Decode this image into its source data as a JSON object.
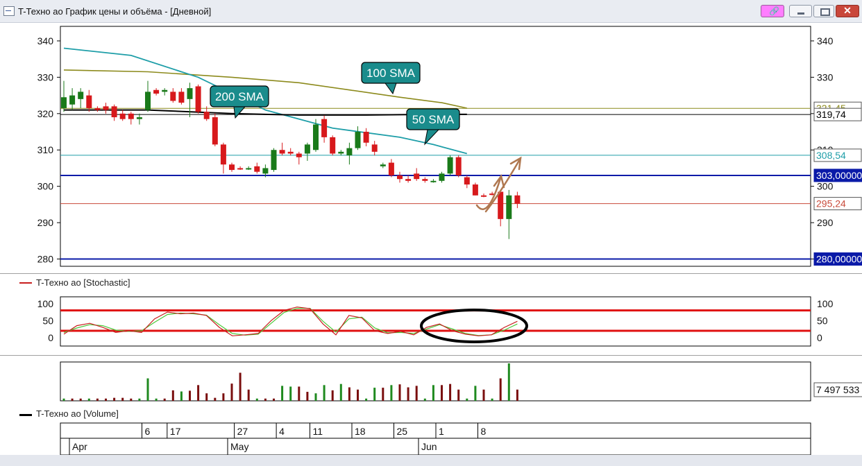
{
  "window": {
    "title": "T-Техно ао График цены и объёма - [Дневной]"
  },
  "legends": {
    "stochastic": "T-Техно ао [Stochastic]",
    "volume": "T-Техно ао [Volume]"
  },
  "colors": {
    "up": "#1a7a1a",
    "down": "#d7191c",
    "vol_up": "#1f8a1f",
    "vol_down": "#7a0e0e",
    "sma50": "#1e9ea8",
    "sma100": "#8c8a1c",
    "sma200": "#000000",
    "level_blue": "#0a1aa8",
    "level_red": "#c84a3a",
    "stoch_band": "#e01010",
    "stoch_k": "#c81e1e",
    "stoch_d": "#4cc83a",
    "callout": "#1a8c8c",
    "arrow": "#b07850"
  },
  "chart_data": [
    {
      "type": "candlestick",
      "title": "T-Техно ао",
      "y_ticks": [
        280,
        290,
        300,
        310,
        320,
        330,
        340
      ],
      "ylim": [
        278,
        344
      ],
      "x_ticks": [
        {
          "label": "6",
          "idx": 5
        },
        {
          "label": "17",
          "idx": 8
        },
        {
          "label": "27",
          "idx": 16
        },
        {
          "label": "4",
          "idx": 21
        },
        {
          "label": "11",
          "idx": 25
        },
        {
          "label": "18",
          "idx": 30
        },
        {
          "label": "25",
          "idx": 35
        },
        {
          "label": "1",
          "idx": 40
        },
        {
          "label": "8",
          "idx": 45
        }
      ],
      "months": [
        {
          "label": "Apr",
          "idx": 1
        },
        {
          "label": "May",
          "idx": 19
        },
        {
          "label": "Jun",
          "idx": 40
        }
      ],
      "candles": [
        {
          "o": 321.5,
          "h": 329,
          "l": 320.5,
          "c": 324.5
        },
        {
          "o": 322.5,
          "h": 327,
          "l": 321,
          "c": 325
        },
        {
          "o": 324,
          "h": 327,
          "l": 321.5,
          "c": 326
        },
        {
          "o": 325,
          "h": 326.5,
          "l": 320.5,
          "c": 321.5
        },
        {
          "o": 321.5,
          "h": 322,
          "l": 320.5,
          "c": 321
        },
        {
          "o": 322,
          "h": 323,
          "l": 320,
          "c": 321
        },
        {
          "o": 322,
          "h": 322.5,
          "l": 318,
          "c": 319
        },
        {
          "o": 320,
          "h": 321,
          "l": 318,
          "c": 318.5
        },
        {
          "o": 320,
          "h": 320.5,
          "l": 317,
          "c": 318.5
        },
        {
          "o": 318.5,
          "h": 320,
          "l": 317,
          "c": 319
        },
        {
          "o": 321,
          "h": 329,
          "l": 320.5,
          "c": 326
        },
        {
          "o": 326.5,
          "h": 327,
          "l": 325,
          "c": 325.5
        },
        {
          "o": 326,
          "h": 327,
          "l": 325,
          "c": 326.5
        },
        {
          "o": 326,
          "h": 327,
          "l": 323,
          "c": 323.5
        },
        {
          "o": 326,
          "h": 327,
          "l": 322.5,
          "c": 323
        },
        {
          "o": 324,
          "h": 328.5,
          "l": 319,
          "c": 327
        },
        {
          "o": 327.5,
          "h": 328,
          "l": 320,
          "c": 320.5
        },
        {
          "o": 320.5,
          "h": 322,
          "l": 318,
          "c": 318.5
        },
        {
          "o": 319,
          "h": 320,
          "l": 311,
          "c": 311.5
        },
        {
          "o": 311.5,
          "h": 312,
          "l": 303.5,
          "c": 306
        },
        {
          "o": 306,
          "h": 306.5,
          "l": 304,
          "c": 304.5
        },
        {
          "o": 305,
          "h": 305.5,
          "l": 304.5,
          "c": 304.8
        },
        {
          "o": 305,
          "h": 305.5,
          "l": 304.5,
          "c": 305
        },
        {
          "o": 305.5,
          "h": 306.5,
          "l": 303.5,
          "c": 304
        },
        {
          "o": 303.5,
          "h": 306,
          "l": 302.5,
          "c": 305
        },
        {
          "o": 304.5,
          "h": 310.5,
          "l": 304,
          "c": 310
        },
        {
          "o": 310,
          "h": 312,
          "l": 308.5,
          "c": 309
        },
        {
          "o": 309.5,
          "h": 310.5,
          "l": 308.5,
          "c": 309
        },
        {
          "o": 309,
          "h": 309.5,
          "l": 306,
          "c": 308
        },
        {
          "o": 309,
          "h": 312,
          "l": 307,
          "c": 311.5
        },
        {
          "o": 310,
          "h": 318.5,
          "l": 309.5,
          "c": 317
        },
        {
          "o": 318.5,
          "h": 319.5,
          "l": 312,
          "c": 313.5
        },
        {
          "o": 313.5,
          "h": 314,
          "l": 308.5,
          "c": 309
        },
        {
          "o": 309,
          "h": 310,
          "l": 308.5,
          "c": 309.5
        },
        {
          "o": 308.5,
          "h": 312,
          "l": 306,
          "c": 310.5
        },
        {
          "o": 310.5,
          "h": 316.5,
          "l": 310,
          "c": 315
        },
        {
          "o": 315,
          "h": 316,
          "l": 311,
          "c": 312
        }
      ],
      "candles_tail": [
        {
          "o": 311.5,
          "h": 312.5,
          "l": 308.5,
          "c": 309.5
        },
        {
          "o": 305.5,
          "h": 306.5,
          "l": 305,
          "c": 306
        },
        {
          "o": 306.5,
          "h": 307.5,
          "l": 302.5,
          "c": 303
        },
        {
          "o": 303,
          "h": 304,
          "l": 301,
          "c": 302
        },
        {
          "o": 302,
          "h": 303,
          "l": 301,
          "c": 301.5
        },
        {
          "o": 303.5,
          "h": 305,
          "l": 301.5,
          "c": 302
        },
        {
          "o": 302,
          "h": 302.5,
          "l": 301,
          "c": 301.5
        },
        {
          "o": 301.5,
          "h": 302,
          "l": 301,
          "c": 301.5
        },
        {
          "o": 301.5,
          "h": 304,
          "l": 301,
          "c": 303.5
        },
        {
          "o": 303.5,
          "h": 308.5,
          "l": 303,
          "c": 308
        },
        {
          "o": 308,
          "h": 308.5,
          "l": 302.5,
          "c": 303
        },
        {
          "o": 302.5,
          "h": 303,
          "l": 299.5,
          "c": 300.5
        },
        {
          "o": 300.5,
          "h": 301,
          "l": 297.5,
          "c": 297.5
        },
        {
          "o": 297.5,
          "h": 298,
          "l": 297,
          "c": 297.3
        },
        {
          "o": 298,
          "h": 298.5,
          "l": 297.5,
          "c": 297.8
        },
        {
          "o": 298.5,
          "h": 299,
          "l": 289,
          "c": 291
        },
        {
          "o": 291,
          "h": 299,
          "l": 285.5,
          "c": 297.5
        },
        {
          "o": 297.5,
          "h": 298.5,
          "l": 294,
          "c": 295.2
        }
      ],
      "sma50": [
        [
          0,
          338
        ],
        [
          8,
          336
        ],
        [
          16,
          330
        ],
        [
          24,
          321
        ],
        [
          32,
          316
        ],
        [
          40,
          313.5
        ],
        [
          44,
          311.5
        ],
        [
          48,
          309
        ]
      ],
      "sma100": [
        [
          0,
          332
        ],
        [
          10,
          331.5
        ],
        [
          20,
          330
        ],
        [
          28,
          328.5
        ],
        [
          34,
          326.5
        ],
        [
          40,
          324.5
        ],
        [
          45,
          323
        ],
        [
          48,
          321.5
        ]
      ],
      "sma200": [
        [
          0,
          321
        ],
        [
          10,
          321
        ],
        [
          20,
          320
        ],
        [
          28,
          319.6
        ],
        [
          36,
          319.6
        ],
        [
          44,
          319.8
        ],
        [
          48,
          319.8
        ]
      ],
      "levels": [
        {
          "value": 321.45,
          "label": "321,45",
          "color": "#8c8a1c",
          "style": "thin"
        },
        {
          "value": 319.74,
          "label": "319,74",
          "color": "#000000",
          "style": "thin"
        },
        {
          "value": 308.54,
          "label": "308,54",
          "color": "#1e9ea8",
          "style": "thin"
        },
        {
          "value": 303.0,
          "label": "303,00000",
          "color": "#0a1aa8",
          "style": "thick"
        },
        {
          "value": 295.24,
          "label": "295,24",
          "color": "#c84a3a",
          "style": "thin"
        },
        {
          "value": 280.0,
          "label": "280,00000",
          "color": "#0a1aa8",
          "style": "thick"
        }
      ],
      "annotations": [
        {
          "text": "100 SMA"
        },
        {
          "text": "200 SMA"
        },
        {
          "text": "50 SMA"
        }
      ]
    },
    {
      "type": "line",
      "title": "T-Техно ао [Stochastic]",
      "y_ticks": [
        0,
        50,
        100
      ],
      "ylim": [
        -25,
        120
      ],
      "bands": [
        80,
        20
      ],
      "k": [
        10,
        35,
        42,
        30,
        15,
        20,
        15,
        55,
        75,
        70,
        72,
        65,
        30,
        5,
        8,
        12,
        50,
        80,
        90,
        85,
        40,
        8,
        65,
        58,
        20,
        12,
        18,
        8,
        30,
        40,
        20,
        10,
        5,
        8,
        30,
        48
      ],
      "d": [
        15,
        28,
        38,
        35,
        22,
        18,
        20,
        45,
        68,
        72,
        70,
        66,
        38,
        12,
        7,
        10,
        42,
        74,
        86,
        86,
        48,
        16,
        55,
        60,
        28,
        14,
        15,
        12,
        25,
        38,
        25,
        12,
        6,
        8,
        22,
        40
      ]
    },
    {
      "type": "bar",
      "title": "T-Техно ао [Volume]",
      "last_value_label": "7 497 533",
      "volumes": [
        {
          "v": 0.06,
          "up": true
        },
        {
          "v": 0.06,
          "up": false
        },
        {
          "v": 0.06,
          "up": false
        },
        {
          "v": 0.06,
          "up": true
        },
        {
          "v": 0.06,
          "up": false
        },
        {
          "v": 0.06,
          "up": false
        },
        {
          "v": 0.08,
          "up": false
        },
        {
          "v": 0.08,
          "up": false
        },
        {
          "v": 0.06,
          "up": false
        },
        {
          "v": 0.06,
          "up": true
        },
        {
          "v": 0.6,
          "up": true
        },
        {
          "v": 0.06,
          "up": true
        },
        {
          "v": 0.06,
          "up": false
        },
        {
          "v": 0.28,
          "up": false
        },
        {
          "v": 0.25,
          "up": true
        },
        {
          "v": 0.27,
          "up": false
        },
        {
          "v": 0.42,
          "up": false
        },
        {
          "v": 0.2,
          "up": false
        },
        {
          "v": 0.08,
          "up": false
        },
        {
          "v": 0.2,
          "up": false
        },
        {
          "v": 0.46,
          "up": false
        },
        {
          "v": 0.75,
          "up": false
        },
        {
          "v": 0.3,
          "up": false
        },
        {
          "v": 0.06,
          "up": true
        },
        {
          "v": 0.06,
          "up": false
        },
        {
          "v": 0.06,
          "up": false
        },
        {
          "v": 0.4,
          "up": true
        },
        {
          "v": 0.38,
          "up": true
        },
        {
          "v": 0.38,
          "up": false
        },
        {
          "v": 0.24,
          "up": false
        },
        {
          "v": 0.2,
          "up": true
        },
        {
          "v": 0.42,
          "up": true
        },
        {
          "v": 0.28,
          "up": false
        },
        {
          "v": 0.45,
          "up": true
        },
        {
          "v": 0.36,
          "up": false
        },
        {
          "v": 0.3,
          "up": false
        },
        {
          "v": 0.06,
          "up": true
        },
        {
          "v": 0.35,
          "up": true
        },
        {
          "v": 0.35,
          "up": false
        },
        {
          "v": 0.42,
          "up": true
        },
        {
          "v": 0.44,
          "up": false
        },
        {
          "v": 0.36,
          "up": false
        },
        {
          "v": 0.4,
          "up": false
        },
        {
          "v": 0.06,
          "up": true
        },
        {
          "v": 0.42,
          "up": true
        },
        {
          "v": 0.42,
          "up": false
        },
        {
          "v": 0.45,
          "up": false
        },
        {
          "v": 0.3,
          "up": false
        },
        {
          "v": 0.06,
          "up": true
        },
        {
          "v": 0.4,
          "up": true
        },
        {
          "v": 0.3,
          "up": false
        },
        {
          "v": 0.06,
          "up": true
        },
        {
          "v": 0.6,
          "up": false
        },
        {
          "v": 1.0,
          "up": true
        },
        {
          "v": 0.3,
          "up": false
        }
      ]
    }
  ]
}
